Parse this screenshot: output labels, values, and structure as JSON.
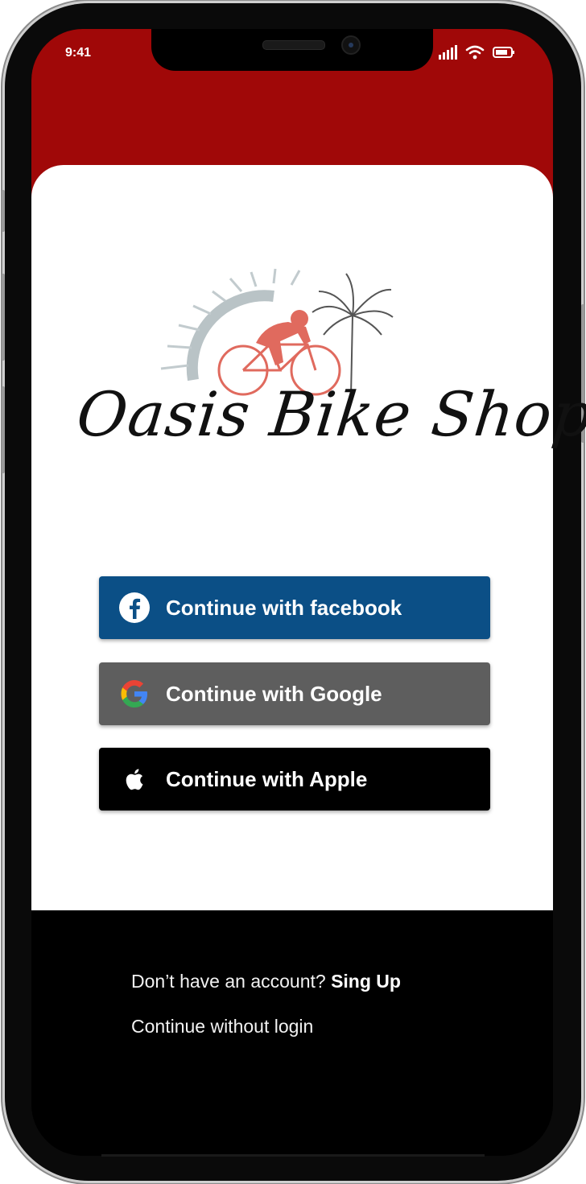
{
  "status_bar": {
    "time": "9:41"
  },
  "brand": {
    "name": "Oasis Bike Shop"
  },
  "auth_buttons": [
    {
      "label": "Continue with facebook",
      "icon": "facebook-icon",
      "color": "#0b4f86"
    },
    {
      "label": "Continue with Google",
      "icon": "google-icon",
      "color": "#5e5e5e"
    },
    {
      "label": "Continue with Apple",
      "icon": "apple-icon",
      "color": "#000000"
    }
  ],
  "footer": {
    "signup_prompt": "Don’t have an account?",
    "signup_link": "Sing Up",
    "guest_link": "Continue without login"
  },
  "colors": {
    "header": "#a00808",
    "background_bottom": "#000000"
  }
}
